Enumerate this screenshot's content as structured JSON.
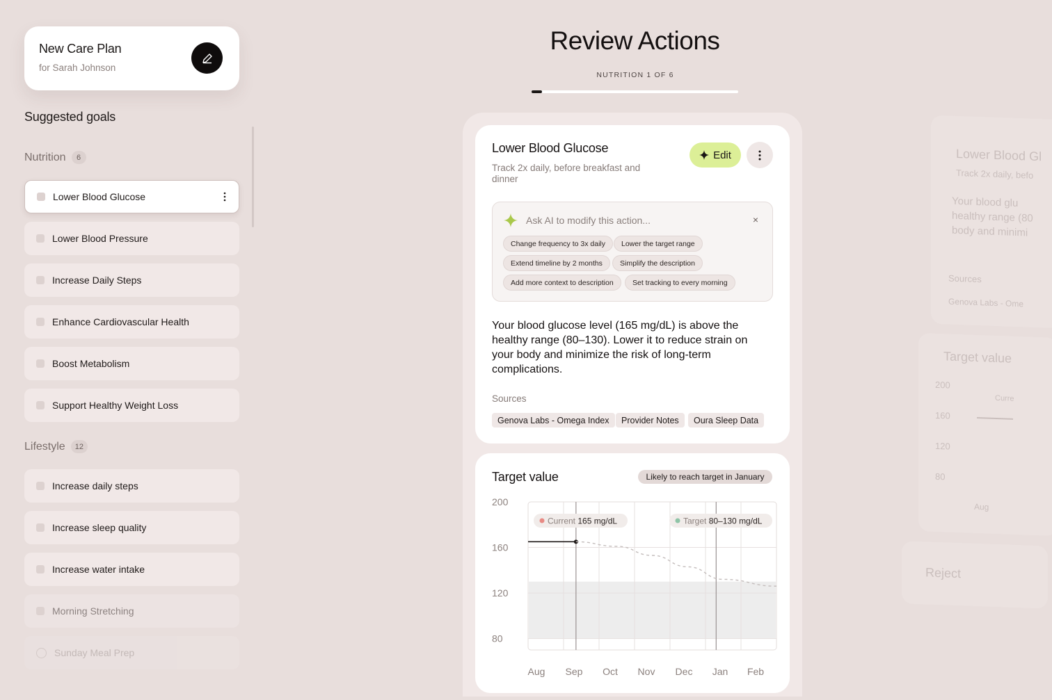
{
  "plan": {
    "title": "New Care Plan",
    "subtitle": "for Sarah Johnson"
  },
  "sidebar": {
    "title": "Suggested goals",
    "nutrition": {
      "label": "Nutrition",
      "count": "6",
      "items": [
        "Lower Blood Glucose",
        "Lower Blood Pressure",
        "Increase Daily Steps",
        "Enhance Cardiovascular Health",
        "Boost Metabolism",
        "Support Healthy Weight Loss"
      ]
    },
    "lifestyle": {
      "label": "Lifestyle",
      "count": "12",
      "items": [
        "Increase daily steps",
        "Increase sleep quality",
        "Increase water intake",
        "Morning Stretching",
        "Sunday Meal Prep"
      ]
    }
  },
  "header": {
    "title": "Review Actions",
    "step": "NUTRITION 1 OF 6",
    "progress": 0.05
  },
  "action": {
    "title": "Lower Blood Glucose",
    "subtitle": "Track 2x daily, before breakfast and dinner",
    "edit_label": "Edit",
    "ai_placeholder": "Ask AI to modify this action...",
    "ai_close": "×",
    "suggestions": [
      "Change frequency to 3x daily",
      "Lower the target range",
      "Extend timeline by 2 months",
      "Simplify the description",
      "Add more context to description",
      "Set tracking to every morning"
    ],
    "explanation": "Your blood glucose level (165 mg/dL) is above the healthy range (80–130). Lower it to reduce strain on your body and minimize the risk of long-term complications.",
    "sources_label": "Sources",
    "sources": [
      "Genova Labs - Omega Index",
      "Provider Notes",
      "Oura Sleep Data"
    ]
  },
  "target": {
    "title": "Target value",
    "badge": "Likely to reach target in January",
    "current_label": "Current",
    "current_value": "165 mg/dL",
    "target_label": "Target",
    "target_value": "80–130 mg/dL"
  },
  "chart_data": {
    "type": "line",
    "x": [
      "Aug",
      "Sep",
      "Oct",
      "Nov",
      "Dec",
      "Jan",
      "Feb"
    ],
    "yticks": [
      200,
      160,
      120,
      80
    ],
    "ylim": [
      70,
      200
    ],
    "target_range": [
      80,
      130
    ],
    "current_value": 165,
    "series": [
      {
        "name": "Current",
        "points": [
          [
            "Aug",
            165
          ],
          [
            "Sep",
            165
          ]
        ]
      },
      {
        "name": "Target",
        "points": [
          [
            "Sep",
            165
          ],
          [
            "Oct",
            161
          ],
          [
            "Nov",
            153
          ],
          [
            "Dec",
            143
          ],
          [
            "Jan",
            132
          ],
          [
            "Feb",
            126
          ]
        ],
        "style": "dashed"
      }
    ],
    "colors": {
      "current": "#e88a84",
      "target": "#8fc4a7"
    }
  },
  "ghost": {
    "title": "Lower Blood Gl",
    "sub": "Track 2x daily, befo",
    "body": [
      "Your blood glu",
      "healthy range (80",
      "body and minimi"
    ],
    "sources": "Sources",
    "source": "Genova Labs - Ome",
    "tv": "Target value",
    "ticks": [
      "200",
      "160",
      "120",
      "80"
    ],
    "current": "Curre",
    "month": "Aug",
    "reject": "Reject"
  }
}
